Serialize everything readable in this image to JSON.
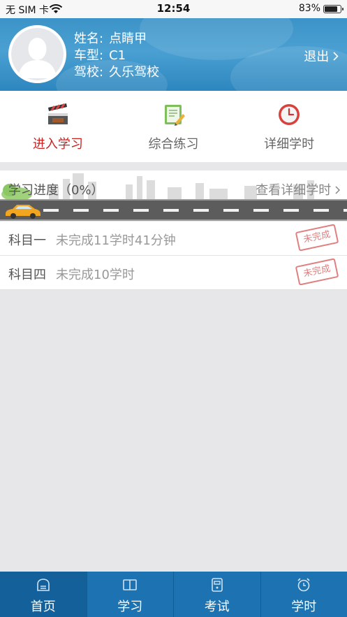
{
  "status_bar": {
    "carrier": "无 SIM 卡",
    "time": "12:54",
    "battery": "83%",
    "battery_level": 0.83
  },
  "profile": {
    "name_key": "姓名:",
    "name": "点睛甲",
    "car_type_key": "车型:",
    "car_type": "C1",
    "school_key": "驾校:",
    "school": "久乐驾校",
    "logout_label": "退出"
  },
  "menu": {
    "items": [
      {
        "label": "进入学习",
        "icon": "clapperboard-icon",
        "active": true
      },
      {
        "label": "综合练习",
        "icon": "document-pen-icon",
        "active": false
      },
      {
        "label": "详细学时",
        "icon": "clock-icon",
        "active": false
      }
    ]
  },
  "progress": {
    "title": "学习进度（0%）",
    "value": 0,
    "link": "查看详细学时"
  },
  "subjects": [
    {
      "name": "科目一",
      "status": "未完成11学时41分钟",
      "stamp": "未完成"
    },
    {
      "name": "科目四",
      "status": "未完成10学时",
      "stamp": "未完成"
    }
  ],
  "tabbar": {
    "tabs": [
      {
        "label": "首页",
        "icon": "home-icon",
        "active": true
      },
      {
        "label": "学习",
        "icon": "book-icon",
        "active": false
      },
      {
        "label": "考试",
        "icon": "exam-icon",
        "active": false
      },
      {
        "label": "学时",
        "icon": "alarm-clock-icon",
        "active": false
      }
    ]
  },
  "colors": {
    "header_blue": "#3c93c7",
    "active_red": "#cc1f1f",
    "tabbar_blue": "#1d73b1",
    "stamp_red": "#e07f7f"
  }
}
